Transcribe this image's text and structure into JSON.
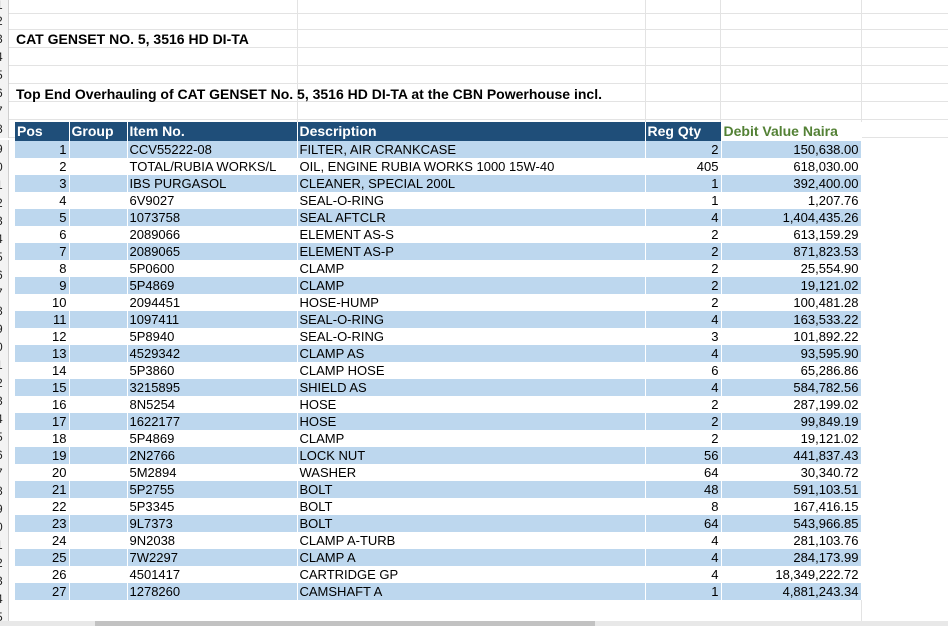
{
  "row_numbers": [
    "1",
    "2",
    "3",
    "4",
    "5",
    "6",
    "7",
    "8",
    "9",
    "0",
    "1",
    "2",
    "3",
    "4",
    "5",
    "6",
    "7",
    "8",
    "9",
    "0",
    "1",
    "2",
    "3",
    "4",
    "5",
    "6",
    "7",
    "8",
    "9",
    "0",
    "1",
    "2",
    "3",
    "4",
    "5"
  ],
  "titles": {
    "genset": "CAT  GENSET NO. 5, 3516 HD DI-TA",
    "overhaul": "Top End Overhauling of CAT GENSET No. 5, 3516 HD DI-TA at the CBN Powerhouse incl."
  },
  "table": {
    "headers": {
      "pos": "Pos",
      "group": "Group",
      "item_no": "Item No.",
      "description": "Description",
      "reg_qty": "Reg Qty",
      "debit_value": "Debit Value Naira"
    },
    "header_colors": {
      "fill": "#1f4e79",
      "text": "#ffffff",
      "debit_text": "#538135",
      "band": "#bdd7ee"
    },
    "rows": [
      {
        "pos": "1",
        "group": "",
        "item": "CCV55222-08",
        "desc": "FILTER, AIR CRANKCASE",
        "qty": "2",
        "value": "150,638.00"
      },
      {
        "pos": "2",
        "group": "",
        "item": "TOTAL/RUBIA WORKS/L",
        "desc": "OIL, ENGINE RUBIA WORKS 1000 15W-40",
        "qty": "405",
        "value": "618,030.00"
      },
      {
        "pos": "3",
        "group": "",
        "item": "IBS PURGASOL",
        "desc": "CLEANER, SPECIAL 200L",
        "qty": "1",
        "value": "392,400.00"
      },
      {
        "pos": "4",
        "group": "",
        "item": "6V9027",
        "desc": "SEAL-O-RING",
        "qty": "1",
        "value": "1,207.76"
      },
      {
        "pos": "5",
        "group": "",
        "item": "1073758",
        "desc": "SEAL AFTCLR",
        "qty": "4",
        "value": "1,404,435.26"
      },
      {
        "pos": "6",
        "group": "",
        "item": "2089066",
        "desc": "ELEMENT AS-S",
        "qty": "2",
        "value": "613,159.29"
      },
      {
        "pos": "7",
        "group": "",
        "item": "2089065",
        "desc": "ELEMENT AS-P",
        "qty": "2",
        "value": "871,823.53"
      },
      {
        "pos": "8",
        "group": "",
        "item": "5P0600",
        "desc": "CLAMP",
        "qty": "2",
        "value": "25,554.90"
      },
      {
        "pos": "9",
        "group": "",
        "item": "5P4869",
        "desc": "CLAMP",
        "qty": "2",
        "value": "19,121.02"
      },
      {
        "pos": "10",
        "group": "",
        "item": "2094451",
        "desc": "HOSE-HUMP",
        "qty": "2",
        "value": "100,481.28"
      },
      {
        "pos": "11",
        "group": "",
        "item": "1097411",
        "desc": "SEAL-O-RING",
        "qty": "4",
        "value": "163,533.22"
      },
      {
        "pos": "12",
        "group": "",
        "item": "5P8940",
        "desc": "SEAL-O-RING",
        "qty": "3",
        "value": "101,892.22"
      },
      {
        "pos": "13",
        "group": "",
        "item": "4529342",
        "desc": "CLAMP AS",
        "qty": "4",
        "value": "93,595.90"
      },
      {
        "pos": "14",
        "group": "",
        "item": "5P3860",
        "desc": "CLAMP HOSE",
        "qty": "6",
        "value": "65,286.86"
      },
      {
        "pos": "15",
        "group": "",
        "item": "3215895",
        "desc": "SHIELD AS",
        "qty": "4",
        "value": "584,782.56"
      },
      {
        "pos": "16",
        "group": "",
        "item": "8N5254",
        "desc": "HOSE",
        "qty": "2",
        "value": "287,199.02"
      },
      {
        "pos": "17",
        "group": "",
        "item": "1622177",
        "desc": "HOSE",
        "qty": "2",
        "value": "99,849.19"
      },
      {
        "pos": "18",
        "group": "",
        "item": "5P4869",
        "desc": "CLAMP",
        "qty": "2",
        "value": "19,121.02"
      },
      {
        "pos": "19",
        "group": "",
        "item": "2N2766",
        "desc": "LOCK NUT",
        "qty": "56",
        "value": "441,837.43"
      },
      {
        "pos": "20",
        "group": "",
        "item": "5M2894",
        "desc": "WASHER",
        "qty": "64",
        "value": "30,340.72"
      },
      {
        "pos": "21",
        "group": "",
        "item": "5P2755",
        "desc": "BOLT",
        "qty": "48",
        "value": "591,103.51"
      },
      {
        "pos": "22",
        "group": "",
        "item": "5P3345",
        "desc": "BOLT",
        "qty": "8",
        "value": "167,416.15"
      },
      {
        "pos": "23",
        "group": "",
        "item": "9L7373",
        "desc": "BOLT",
        "qty": "64",
        "value": "543,966.85"
      },
      {
        "pos": "24",
        "group": "",
        "item": "9N2038",
        "desc": "CLAMP A-TURB",
        "qty": "4",
        "value": "281,103.76"
      },
      {
        "pos": "25",
        "group": "",
        "item": "7W2297",
        "desc": "CLAMP A",
        "qty": "4",
        "value": "284,173.99"
      },
      {
        "pos": "26",
        "group": "",
        "item": "4501417",
        "desc": "CARTRIDGE GP",
        "qty": "4",
        "value": "18,349,222.72"
      },
      {
        "pos": "27",
        "group": "",
        "item": "1278260",
        "desc": "CAMSHAFT A",
        "qty": "1",
        "value": "4,881,243.34"
      }
    ]
  }
}
